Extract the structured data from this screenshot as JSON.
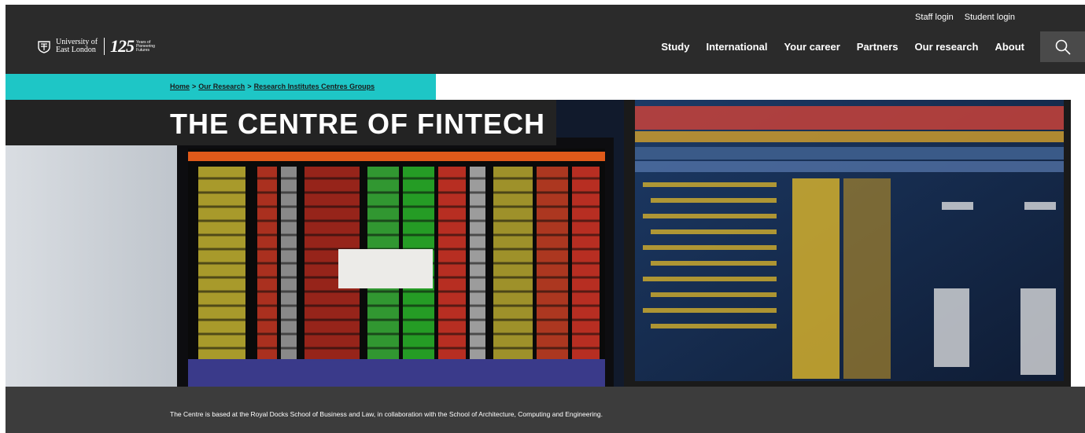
{
  "header": {
    "util_links": [
      "Staff login",
      "Student login"
    ],
    "logo": {
      "line1": "University of",
      "line2": "East London",
      "anniversary": "125",
      "anniversary_sub": [
        "Years of",
        "Pioneering",
        "Futures"
      ]
    },
    "nav": [
      "Study",
      "International",
      "Your career",
      "Partners",
      "Our research",
      "About"
    ],
    "search_icon": "search-icon"
  },
  "breadcrumb": {
    "items": [
      "Home",
      "Our Research",
      "Research Institutes Centres Groups"
    ],
    "separator": ">"
  },
  "hero": {
    "title": "THE CENTRE OF FINTECH",
    "image": "trading-screens-photo"
  },
  "intro": {
    "text": "The Centre is based at the Royal Docks School of Business and Law, in collaboration with the School of Architecture, Computing and Engineering."
  },
  "colors": {
    "header_bg": "#2b2b2b",
    "accent_teal": "#1ec6c6",
    "intro_bg": "#3c3c3c"
  }
}
